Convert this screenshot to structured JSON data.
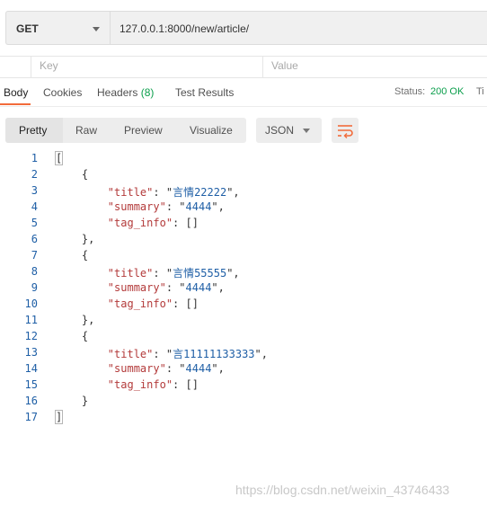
{
  "request": {
    "method": "GET",
    "url": "127.0.0.1:8000/new/article/"
  },
  "params": {
    "key_placeholder": "Key",
    "value_placeholder": "Value"
  },
  "response_tabs": [
    {
      "label": "Body"
    },
    {
      "label": "Cookies"
    },
    {
      "label": "Headers",
      "count": "(8)"
    },
    {
      "label": "Test Results"
    }
  ],
  "status": {
    "label": "Status:",
    "value": "200 OK",
    "time_label_partial": "Ti"
  },
  "view_modes": [
    "Pretty",
    "Raw",
    "Preview",
    "Visualize"
  ],
  "format": "JSON",
  "body": {
    "line_numbers": [
      "1",
      "2",
      "3",
      "4",
      "5",
      "6",
      "7",
      "8",
      "9",
      "10",
      "11",
      "12",
      "13",
      "14",
      "15",
      "16",
      "17"
    ],
    "articles": [
      {
        "title": "言情22222",
        "summary": "4444",
        "tag_info": "[]"
      },
      {
        "title": "言情55555",
        "summary": "4444",
        "tag_info": "[]"
      },
      {
        "title": "言11111133333",
        "summary": "4444",
        "tag_info": "[]"
      }
    ],
    "keys": {
      "title": "\"title\"",
      "summary": "\"summary\"",
      "tag_info": "\"tag_info\""
    }
  },
  "watermark": "https://blog.csdn.net/weixin_43746433",
  "colors": {
    "accent": "#f26b3a",
    "status_ok": "#0a9e4b",
    "json_key": "#b33a3a",
    "json_string": "#1f5fa6"
  }
}
